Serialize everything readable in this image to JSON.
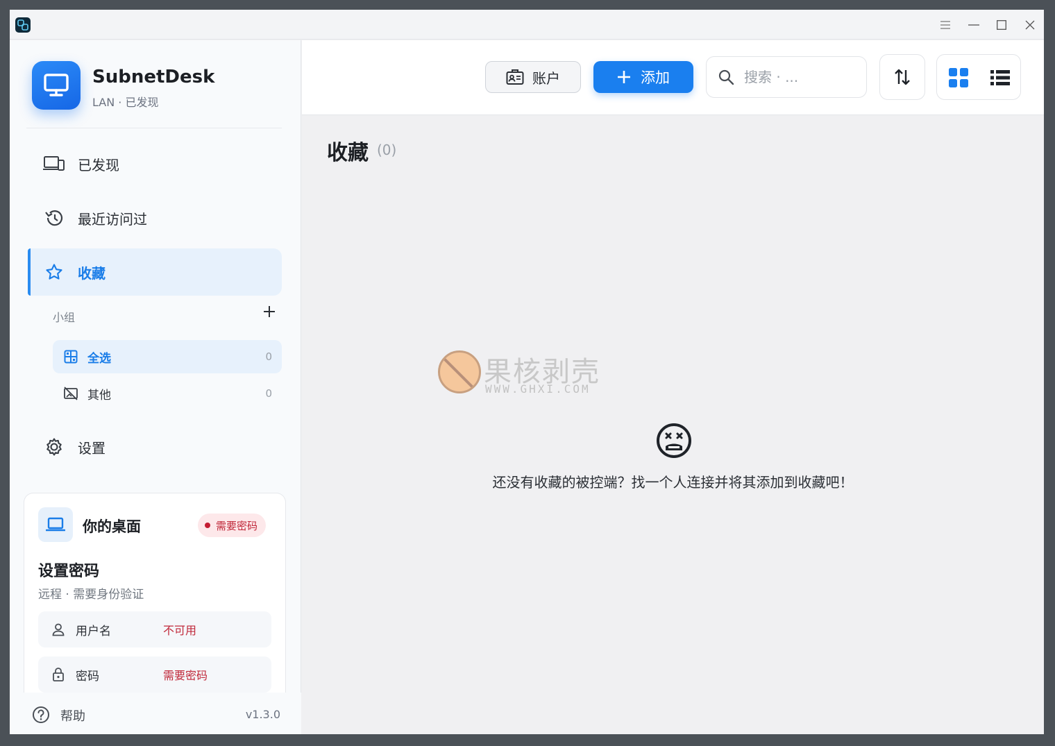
{
  "titlebar": {
    "menu_icon": "hamburger-icon",
    "minimize_icon": "minimize-icon",
    "maximize_icon": "maximize-icon",
    "close_icon": "close-icon"
  },
  "brand": {
    "name": "SubnetDesk",
    "subtitle": "LAN · 已发现"
  },
  "sidebar": {
    "nav": [
      {
        "label": "已发现",
        "icon": "devices-icon"
      },
      {
        "label": "最近访问过",
        "icon": "history-icon"
      },
      {
        "label": "收藏",
        "icon": "star-icon",
        "active": true
      },
      {
        "label": "设置",
        "icon": "gear-icon"
      }
    ],
    "groups_title": "小组",
    "groups": [
      {
        "label": "全选",
        "count": "0",
        "icon": "layout-icon",
        "active": true
      },
      {
        "label": "其他",
        "count": "0",
        "icon": "no-image-icon"
      }
    ]
  },
  "device_card": {
    "title": "你的桌面",
    "badge": "需要密码",
    "heading": "设置密码",
    "subtitle": "远程 · 需要身份验证",
    "fields": [
      {
        "label": "用户名",
        "value": "不可用",
        "icon": "user-icon"
      },
      {
        "label": "密码",
        "value": "需要密码",
        "icon": "lock-icon"
      }
    ]
  },
  "footer": {
    "help_label": "帮助",
    "version": "v1.3.0"
  },
  "toolbar": {
    "account_label": "账户",
    "add_label": "添加",
    "search_placeholder": "搜索 · ..."
  },
  "content": {
    "title": "收藏",
    "count": "(0)",
    "empty_message": "还没有收藏的被控端？找一个人连接并将其添加到收藏吧！"
  },
  "watermark": {
    "text": "果核剥壳",
    "url": "WWW.GHXI.COM"
  },
  "colors": {
    "accent": "#1a7fef",
    "active_bg": "#e7f1fc",
    "warning": "#c0283a"
  }
}
